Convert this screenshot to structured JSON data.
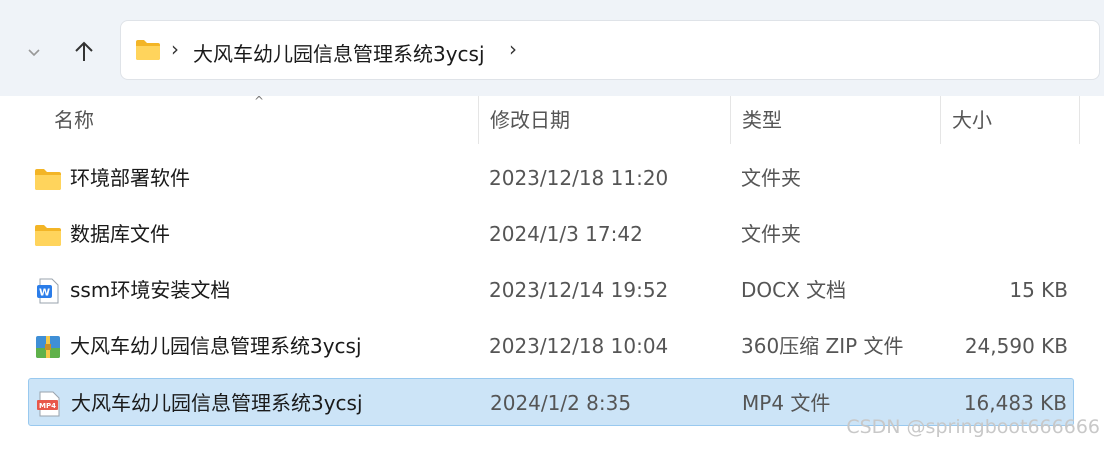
{
  "address_bar": {
    "breadcrumb": "大风车幼儿园信息管理系统3ycsj",
    "separator": "›"
  },
  "columns": {
    "name": "名称",
    "date": "修改日期",
    "type": "类型",
    "size": "大小",
    "sort_indicator": "^"
  },
  "files": [
    {
      "name": "环境部署软件",
      "date": "2023/12/18 11:20",
      "type": "文件夹",
      "size": "",
      "icon": "folder-icon"
    },
    {
      "name": "数据库文件",
      "date": "2024/1/3 17:42",
      "type": "文件夹",
      "size": "",
      "icon": "folder-icon"
    },
    {
      "name": "ssm环境安装文档",
      "date": "2023/12/14 19:52",
      "type": "DOCX 文档",
      "size": "15 KB",
      "icon": "docx-icon"
    },
    {
      "name": "大风车幼儿园信息管理系统3ycsj",
      "date": "2023/12/18 10:04",
      "type": "360压缩 ZIP 文件",
      "size": "24,590 KB",
      "icon": "zip-archive-icon"
    },
    {
      "name": "大风车幼儿园信息管理系统3ycsj",
      "date": "2024/1/2 8:35",
      "type": "MP4 文件",
      "size": "16,483 KB",
      "icon": "mp4-file-icon",
      "selected": true
    }
  ],
  "icon_labels": {
    "docx": "W",
    "mp4": "MP4"
  },
  "watermark": "CSDN @springboot666666",
  "colors": {
    "selected_bg": "#cce4f7",
    "selected_border": "#99c9ef",
    "folder": "#f8c842"
  }
}
